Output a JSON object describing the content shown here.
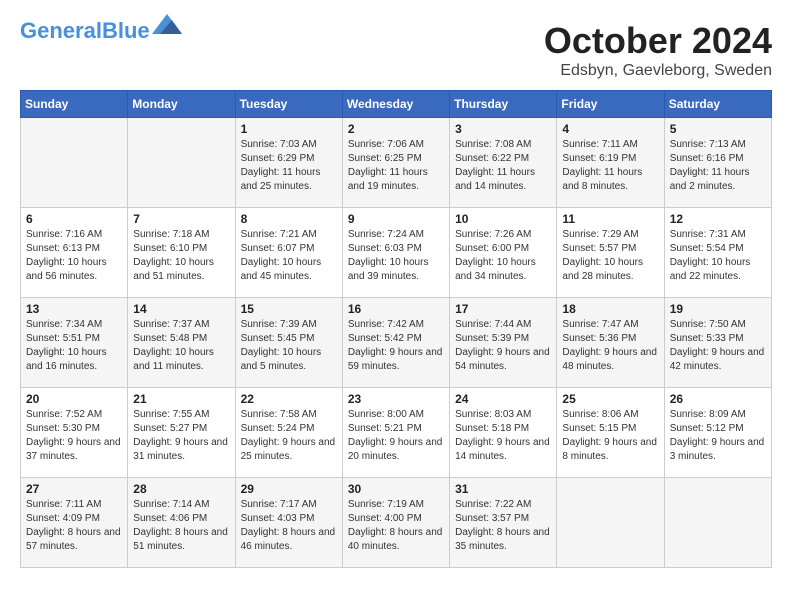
{
  "header": {
    "logo_line1": "General",
    "logo_line2": "Blue",
    "month": "October 2024",
    "location": "Edsbyn, Gaevleborg, Sweden"
  },
  "weekdays": [
    "Sunday",
    "Monday",
    "Tuesday",
    "Wednesday",
    "Thursday",
    "Friday",
    "Saturday"
  ],
  "weeks": [
    [
      {
        "day": "",
        "sunrise": "",
        "sunset": "",
        "daylight": ""
      },
      {
        "day": "",
        "sunrise": "",
        "sunset": "",
        "daylight": ""
      },
      {
        "day": "1",
        "sunrise": "Sunrise: 7:03 AM",
        "sunset": "Sunset: 6:29 PM",
        "daylight": "Daylight: 11 hours and 25 minutes."
      },
      {
        "day": "2",
        "sunrise": "Sunrise: 7:06 AM",
        "sunset": "Sunset: 6:25 PM",
        "daylight": "Daylight: 11 hours and 19 minutes."
      },
      {
        "day": "3",
        "sunrise": "Sunrise: 7:08 AM",
        "sunset": "Sunset: 6:22 PM",
        "daylight": "Daylight: 11 hours and 14 minutes."
      },
      {
        "day": "4",
        "sunrise": "Sunrise: 7:11 AM",
        "sunset": "Sunset: 6:19 PM",
        "daylight": "Daylight: 11 hours and 8 minutes."
      },
      {
        "day": "5",
        "sunrise": "Sunrise: 7:13 AM",
        "sunset": "Sunset: 6:16 PM",
        "daylight": "Daylight: 11 hours and 2 minutes."
      }
    ],
    [
      {
        "day": "6",
        "sunrise": "Sunrise: 7:16 AM",
        "sunset": "Sunset: 6:13 PM",
        "daylight": "Daylight: 10 hours and 56 minutes."
      },
      {
        "day": "7",
        "sunrise": "Sunrise: 7:18 AM",
        "sunset": "Sunset: 6:10 PM",
        "daylight": "Daylight: 10 hours and 51 minutes."
      },
      {
        "day": "8",
        "sunrise": "Sunrise: 7:21 AM",
        "sunset": "Sunset: 6:07 PM",
        "daylight": "Daylight: 10 hours and 45 minutes."
      },
      {
        "day": "9",
        "sunrise": "Sunrise: 7:24 AM",
        "sunset": "Sunset: 6:03 PM",
        "daylight": "Daylight: 10 hours and 39 minutes."
      },
      {
        "day": "10",
        "sunrise": "Sunrise: 7:26 AM",
        "sunset": "Sunset: 6:00 PM",
        "daylight": "Daylight: 10 hours and 34 minutes."
      },
      {
        "day": "11",
        "sunrise": "Sunrise: 7:29 AM",
        "sunset": "Sunset: 5:57 PM",
        "daylight": "Daylight: 10 hours and 28 minutes."
      },
      {
        "day": "12",
        "sunrise": "Sunrise: 7:31 AM",
        "sunset": "Sunset: 5:54 PM",
        "daylight": "Daylight: 10 hours and 22 minutes."
      }
    ],
    [
      {
        "day": "13",
        "sunrise": "Sunrise: 7:34 AM",
        "sunset": "Sunset: 5:51 PM",
        "daylight": "Daylight: 10 hours and 16 minutes."
      },
      {
        "day": "14",
        "sunrise": "Sunrise: 7:37 AM",
        "sunset": "Sunset: 5:48 PM",
        "daylight": "Daylight: 10 hours and 11 minutes."
      },
      {
        "day": "15",
        "sunrise": "Sunrise: 7:39 AM",
        "sunset": "Sunset: 5:45 PM",
        "daylight": "Daylight: 10 hours and 5 minutes."
      },
      {
        "day": "16",
        "sunrise": "Sunrise: 7:42 AM",
        "sunset": "Sunset: 5:42 PM",
        "daylight": "Daylight: 9 hours and 59 minutes."
      },
      {
        "day": "17",
        "sunrise": "Sunrise: 7:44 AM",
        "sunset": "Sunset: 5:39 PM",
        "daylight": "Daylight: 9 hours and 54 minutes."
      },
      {
        "day": "18",
        "sunrise": "Sunrise: 7:47 AM",
        "sunset": "Sunset: 5:36 PM",
        "daylight": "Daylight: 9 hours and 48 minutes."
      },
      {
        "day": "19",
        "sunrise": "Sunrise: 7:50 AM",
        "sunset": "Sunset: 5:33 PM",
        "daylight": "Daylight: 9 hours and 42 minutes."
      }
    ],
    [
      {
        "day": "20",
        "sunrise": "Sunrise: 7:52 AM",
        "sunset": "Sunset: 5:30 PM",
        "daylight": "Daylight: 9 hours and 37 minutes."
      },
      {
        "day": "21",
        "sunrise": "Sunrise: 7:55 AM",
        "sunset": "Sunset: 5:27 PM",
        "daylight": "Daylight: 9 hours and 31 minutes."
      },
      {
        "day": "22",
        "sunrise": "Sunrise: 7:58 AM",
        "sunset": "Sunset: 5:24 PM",
        "daylight": "Daylight: 9 hours and 25 minutes."
      },
      {
        "day": "23",
        "sunrise": "Sunrise: 8:00 AM",
        "sunset": "Sunset: 5:21 PM",
        "daylight": "Daylight: 9 hours and 20 minutes."
      },
      {
        "day": "24",
        "sunrise": "Sunrise: 8:03 AM",
        "sunset": "Sunset: 5:18 PM",
        "daylight": "Daylight: 9 hours and 14 minutes."
      },
      {
        "day": "25",
        "sunrise": "Sunrise: 8:06 AM",
        "sunset": "Sunset: 5:15 PM",
        "daylight": "Daylight: 9 hours and 8 minutes."
      },
      {
        "day": "26",
        "sunrise": "Sunrise: 8:09 AM",
        "sunset": "Sunset: 5:12 PM",
        "daylight": "Daylight: 9 hours and 3 minutes."
      }
    ],
    [
      {
        "day": "27",
        "sunrise": "Sunrise: 7:11 AM",
        "sunset": "Sunset: 4:09 PM",
        "daylight": "Daylight: 8 hours and 57 minutes."
      },
      {
        "day": "28",
        "sunrise": "Sunrise: 7:14 AM",
        "sunset": "Sunset: 4:06 PM",
        "daylight": "Daylight: 8 hours and 51 minutes."
      },
      {
        "day": "29",
        "sunrise": "Sunrise: 7:17 AM",
        "sunset": "Sunset: 4:03 PM",
        "daylight": "Daylight: 8 hours and 46 minutes."
      },
      {
        "day": "30",
        "sunrise": "Sunrise: 7:19 AM",
        "sunset": "Sunset: 4:00 PM",
        "daylight": "Daylight: 8 hours and 40 minutes."
      },
      {
        "day": "31",
        "sunrise": "Sunrise: 7:22 AM",
        "sunset": "Sunset: 3:57 PM",
        "daylight": "Daylight: 8 hours and 35 minutes."
      },
      {
        "day": "",
        "sunrise": "",
        "sunset": "",
        "daylight": ""
      },
      {
        "day": "",
        "sunrise": "",
        "sunset": "",
        "daylight": ""
      }
    ]
  ]
}
